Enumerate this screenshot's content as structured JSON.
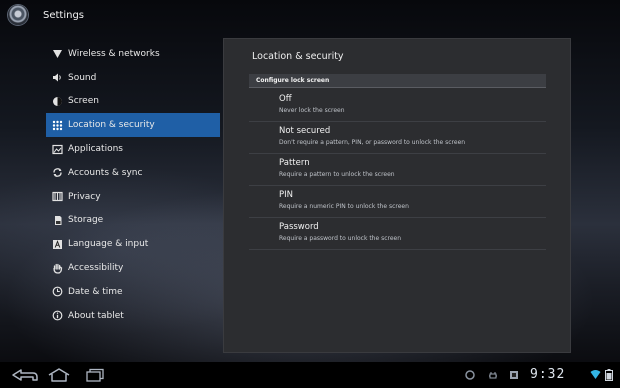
{
  "app": {
    "title": "Settings"
  },
  "sidebar": {
    "items": [
      {
        "label": "Wireless & networks",
        "icon": "wireless-icon",
        "selected": false
      },
      {
        "label": "Sound",
        "icon": "sound-icon",
        "selected": false
      },
      {
        "label": "Screen",
        "icon": "screen-icon",
        "selected": false
      },
      {
        "label": "Location & security",
        "icon": "location-security-icon",
        "selected": true
      },
      {
        "label": "Applications",
        "icon": "applications-icon",
        "selected": false
      },
      {
        "label": "Accounts & sync",
        "icon": "sync-icon",
        "selected": false
      },
      {
        "label": "Privacy",
        "icon": "privacy-icon",
        "selected": false
      },
      {
        "label": "Storage",
        "icon": "storage-icon",
        "selected": false
      },
      {
        "label": "Language & input",
        "icon": "language-icon",
        "selected": false
      },
      {
        "label": "Accessibility",
        "icon": "accessibility-icon",
        "selected": false
      },
      {
        "label": "Date & time",
        "icon": "clock-icon",
        "selected": false
      },
      {
        "label": "About tablet",
        "icon": "info-icon",
        "selected": false
      }
    ]
  },
  "panel": {
    "title": "Location & security",
    "section_header": "Configure lock screen",
    "options": [
      {
        "title": "Off",
        "subtitle": "Never lock the screen"
      },
      {
        "title": "Not secured",
        "subtitle": "Don't require a pattern, PIN, or password to unlock the screen"
      },
      {
        "title": "Pattern",
        "subtitle": "Require a pattern to unlock the screen"
      },
      {
        "title": "PIN",
        "subtitle": "Require a numeric PIN to unlock the screen"
      },
      {
        "title": "Password",
        "subtitle": "Require a password to unlock the screen"
      }
    ]
  },
  "navbar": {
    "time": "9:32",
    "buttons": [
      "back-icon",
      "home-icon",
      "recent-apps-icon"
    ],
    "status_icons": [
      "notification-icon",
      "usb-debug-icon",
      "storage-notification-icon",
      "wifi-icon",
      "battery-icon"
    ]
  },
  "colors": {
    "selected": "#1f5fa6",
    "panel": "#2c2d30",
    "accent": "#33b5e5"
  }
}
